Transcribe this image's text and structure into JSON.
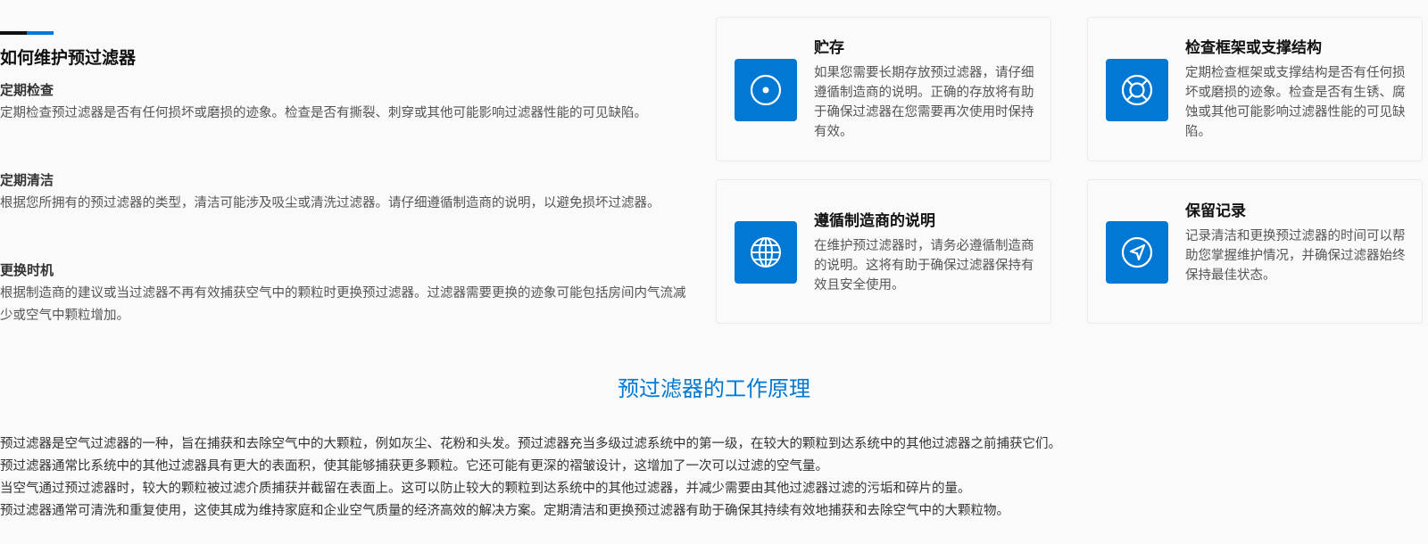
{
  "maintenance": {
    "title": "如何维护预过滤器",
    "items": [
      {
        "title": "定期检查",
        "text": "定期检查预过滤器是否有任何损坏或磨损的迹象。检查是否有撕裂、刺穿或其他可能影响过滤器性能的可见缺陷。"
      },
      {
        "title": "定期清洁",
        "text": "根据您所拥有的预过滤器的类型，清洁可能涉及吸尘或清洗过滤器。请仔细遵循制造商的说明，以避免损坏过滤器。"
      },
      {
        "title": "更换时机",
        "text": "根据制造商的建议或当过滤器不再有效捕获空气中的颗粒时更换预过滤器。过滤器需要更换的迹象可能包括房间内气流减少或空气中颗粒增加。"
      }
    ]
  },
  "cards": [
    {
      "icon": "target-icon",
      "title": "贮存",
      "text": "如果您需要长期存放预过滤器，请仔细遵循制造商的说明。正确的存放将有助于确保过滤器在您需要再次使用时保持有效。"
    },
    {
      "icon": "lifebuoy-icon",
      "title": "检查框架或支撑结构",
      "text": "定期检查框架或支撑结构是否有任何损坏或磨损的迹象。检查是否有生锈、腐蚀或其他可能影响过滤器性能的可见缺陷。"
    },
    {
      "icon": "globe-icon",
      "title": "遵循制造商的说明",
      "text": "在维护预过滤器时，请务必遵循制造商的说明。这将有助于确保过滤器保持有效且安全使用。"
    },
    {
      "icon": "navigation-icon",
      "title": "保留记录",
      "text": "记录清洁和更换预过滤器的时间可以帮助您掌握维护情况，并确保过滤器始终保持最佳状态。"
    }
  ],
  "principle": {
    "title": "预过滤器的工作原理",
    "lines": [
      "预过滤器是空气过滤器的一种，旨在捕获和去除空气中的大颗粒，例如灰尘、花粉和头发。预过滤器充当多级过滤系统中的第一级，在较大的颗粒到达系统中的其他过滤器之前捕获它们。",
      "预过滤器通常比系统中的其他过滤器具有更大的表面积，使其能够捕获更多颗粒。它还可能有更深的褶皱设计，这增加了一次可以过滤的空气量。",
      "当空气通过预过滤器时，较大的颗粒被过滤介质捕获并截留在表面上。这可以防止较大的颗粒到达系统中的其他过滤器，并减少需要由其他过滤器过滤的污垢和碎片的量。",
      "预过滤器通常可清洗和重复使用，这使其成为维持家庭和企业空气质量的经济高效的解决方案。定期清洁和更换预过滤器有助于确保其持续有效地捕获和去除空气中的大颗粒物。"
    ]
  },
  "colors": {
    "accent": "#0078d4",
    "accent_dark": "#111111"
  }
}
